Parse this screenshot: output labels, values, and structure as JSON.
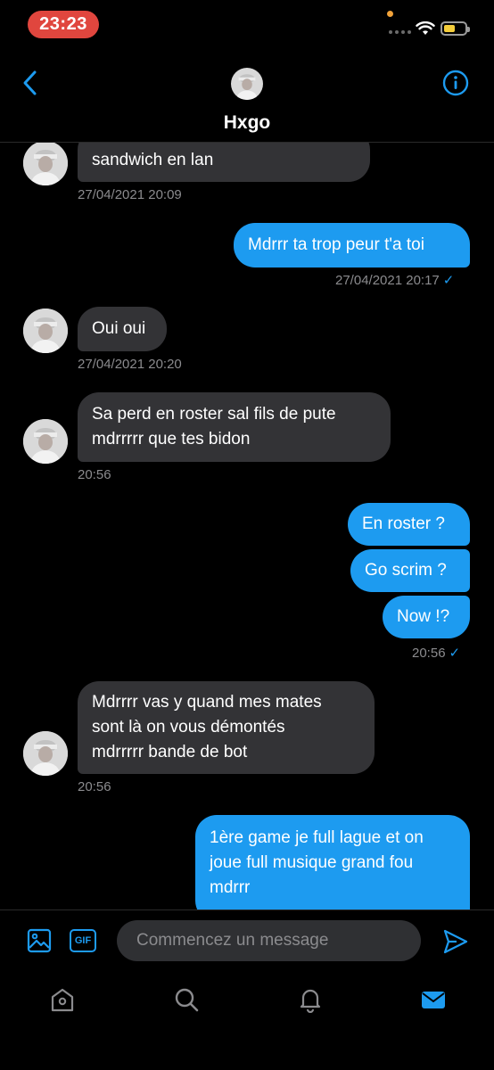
{
  "status_bar": {
    "time": "23:23"
  },
  "header": {
    "contact_name": "Hxgo"
  },
  "messages": [
    {
      "direction": "in",
      "text": "sandwich en lan",
      "timestamp": "27/04/2021 20:09"
    },
    {
      "direction": "out",
      "text": "Mdrrr ta trop peur t'a toi",
      "timestamp": "27/04/2021 20:17"
    },
    {
      "direction": "in",
      "text": "Oui oui",
      "timestamp": "27/04/2021 20:20"
    },
    {
      "direction": "in",
      "lines": [
        "Sa perd en roster sal fils de pute",
        "mdrrrrr que tes bidon"
      ],
      "timestamp": "20:56"
    },
    {
      "direction": "out",
      "text": "En roster ?"
    },
    {
      "direction": "out",
      "text": "Go scrim ?"
    },
    {
      "direction": "out",
      "text": "Now !?",
      "timestamp": "20:56"
    },
    {
      "direction": "in",
      "lines": [
        "Mdrrrr vas y quand mes mates",
        "sont là on vous démontés",
        "mdrrrrr bande de bot"
      ],
      "timestamp": "20:56"
    },
    {
      "direction": "out",
      "lines": [
        "1ère game je full lague et on",
        "joue full musique grand fou",
        "mdrrr"
      ]
    }
  ],
  "composer": {
    "gif_label": "GIF",
    "placeholder": "Commencez un message"
  },
  "colors": {
    "accent": "#1d9bf0",
    "incoming_bubble": "#333336",
    "background": "#000000",
    "status_time_pill": "#e0463e"
  },
  "tabs": [
    "home-icon",
    "search-icon",
    "notifications-icon",
    "messages-icon"
  ]
}
